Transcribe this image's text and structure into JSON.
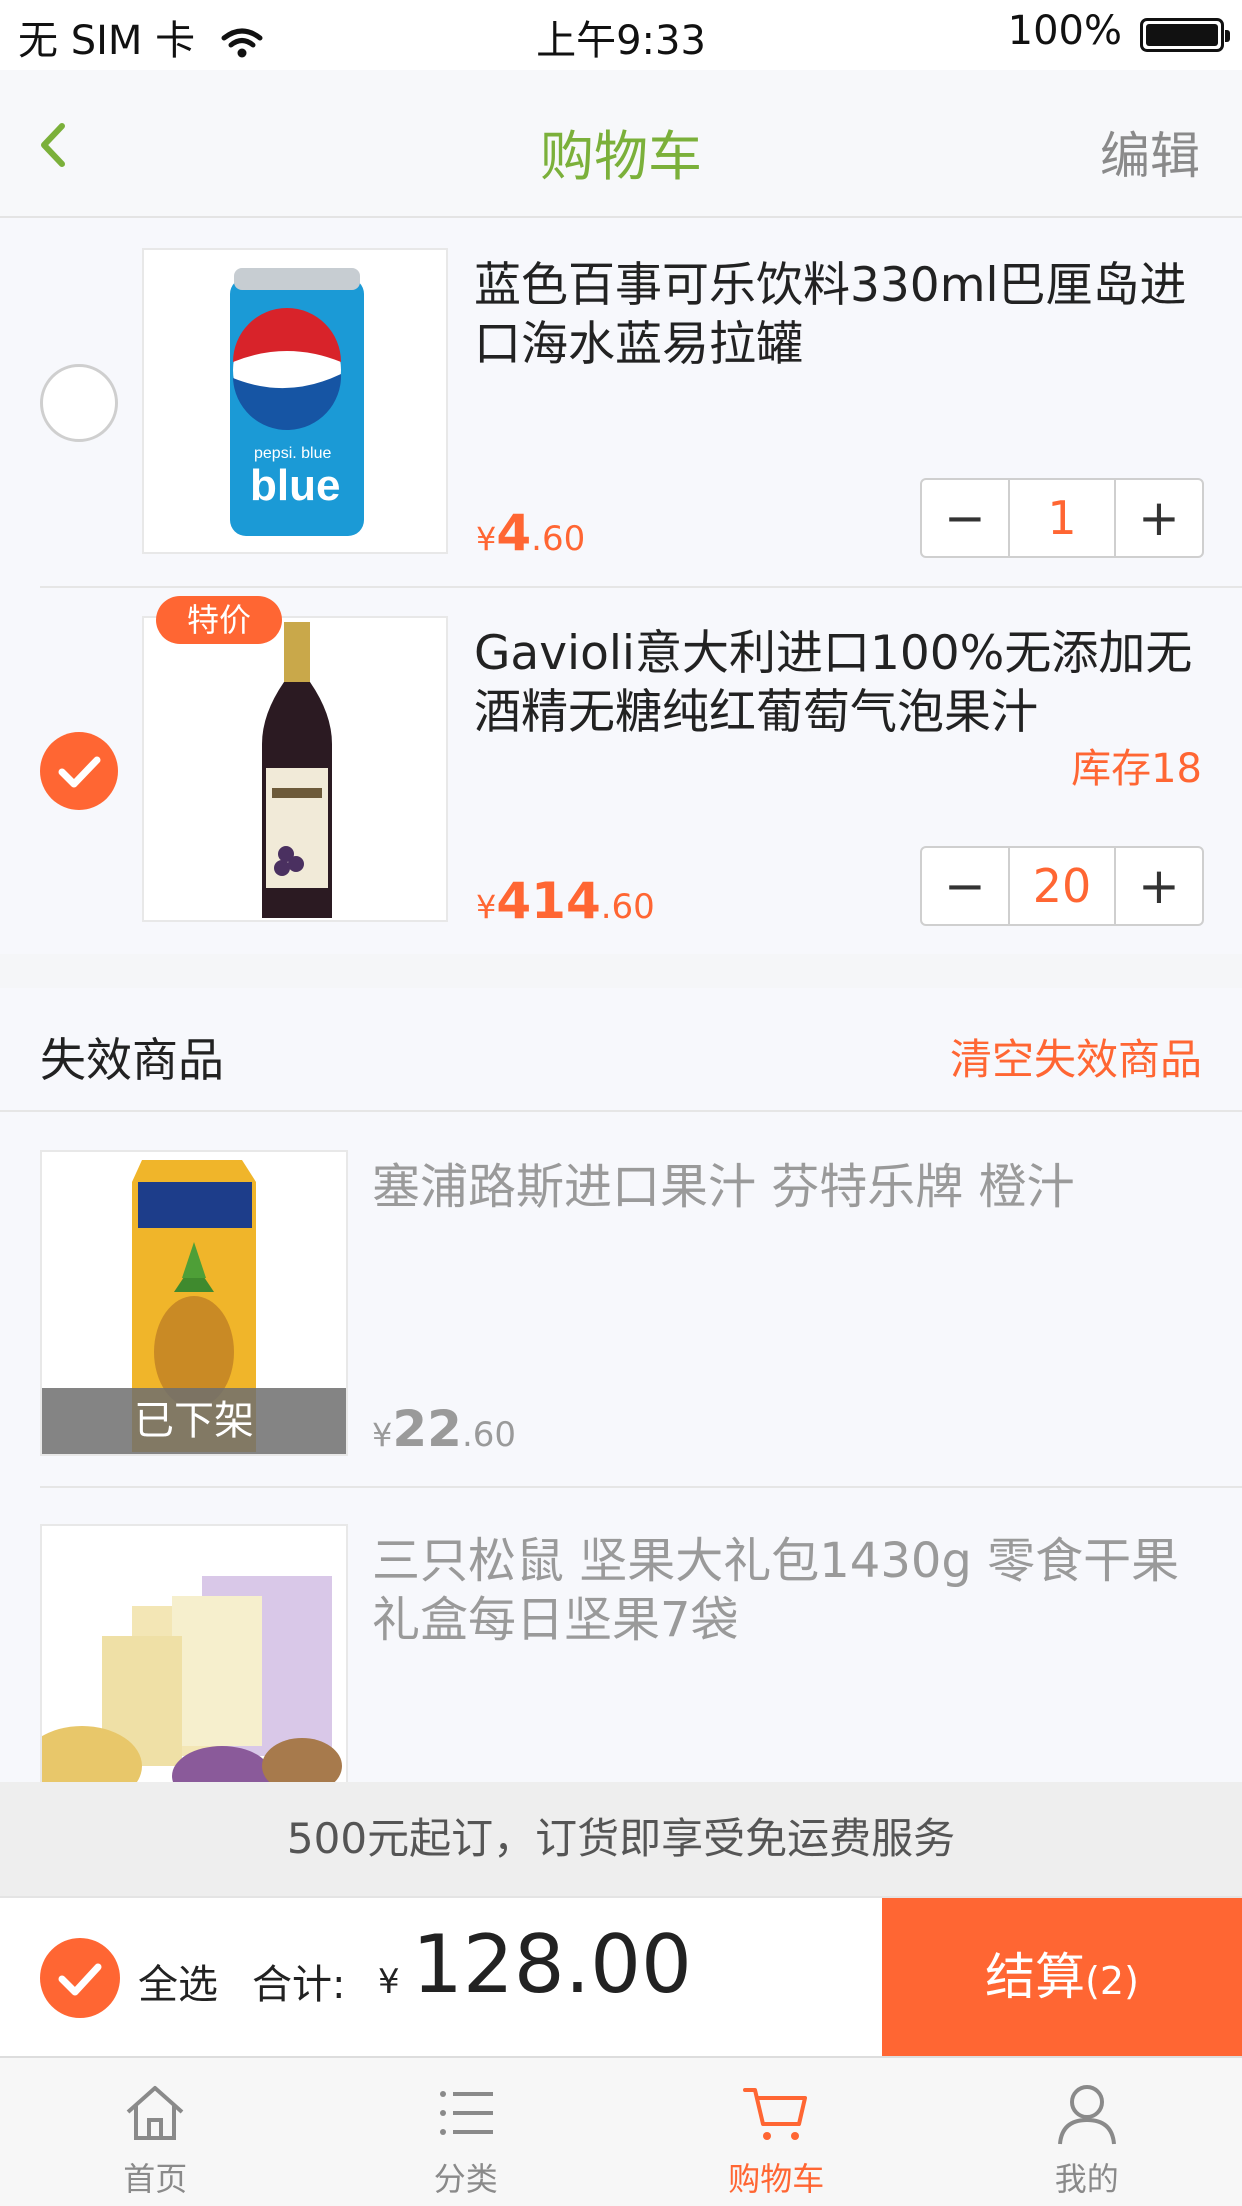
{
  "status_bar": {
    "carrier": "无 SIM 卡",
    "time": "上午9:33",
    "battery": "100%"
  },
  "nav": {
    "title": "购物车",
    "edit": "编辑"
  },
  "cart_items": [
    {
      "title": "蓝色百事可乐饮料330ml巴厘岛进口海水蓝易拉罐",
      "price_currency": "¥",
      "price_int": "4",
      "price_dec": ".60",
      "quantity": "1",
      "selected": false,
      "image_label": "pepsi. blue"
    },
    {
      "badge": "特价",
      "title": "Gavioli意大利进口100%无添加无酒精无糖纯红葡萄气泡果汁",
      "stock": "库存18",
      "price_currency": "¥",
      "price_int": "414",
      "price_dec": ".60",
      "quantity": "20",
      "selected": true
    }
  ],
  "invalid": {
    "title": "失效商品",
    "clear": "清空失效商品",
    "items": [
      {
        "title": "塞浦路斯进口果汁 芬特乐牌 橙汁",
        "status": "已下架",
        "price_currency": "¥",
        "price_int": "22",
        "price_dec": ".60"
      },
      {
        "title": "三只松鼠 坚果大礼包1430g 零食干果礼盒每日坚果7袋"
      }
    ]
  },
  "banner": "500元起订，订货即享受免运费服务",
  "checkout": {
    "select_all": "全选",
    "total_label": "合计:",
    "currency": "¥",
    "total": "128.00",
    "button": "结算",
    "count": "(2)"
  },
  "tabs": [
    {
      "label": "首页",
      "icon": "home-icon"
    },
    {
      "label": "分类",
      "icon": "list-icon"
    },
    {
      "label": "购物车",
      "icon": "cart-icon",
      "active": true
    },
    {
      "label": "我的",
      "icon": "user-icon"
    }
  ],
  "colors": {
    "accent": "#ff6633",
    "nav_title": "#7bb03a"
  }
}
